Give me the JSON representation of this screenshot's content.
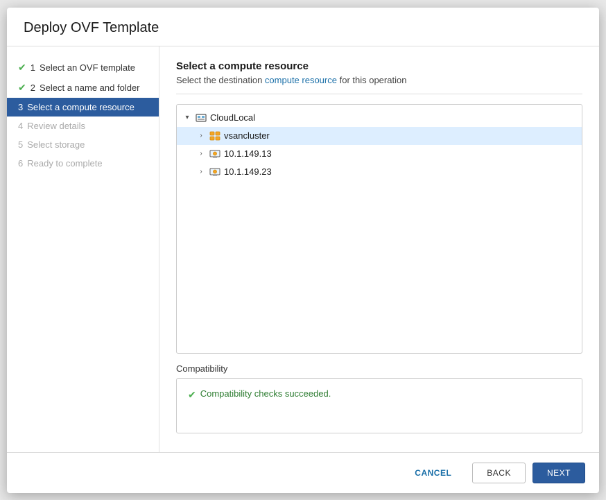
{
  "dialog": {
    "title": "Deploy OVF Template"
  },
  "sidebar": {
    "items": [
      {
        "id": "step1",
        "number": "1",
        "label": "Select an OVF template",
        "state": "completed"
      },
      {
        "id": "step2",
        "number": "2",
        "label": "Select a name and folder",
        "state": "completed"
      },
      {
        "id": "step3",
        "number": "3",
        "label": "Select a compute resource",
        "state": "active"
      },
      {
        "id": "step4",
        "number": "4",
        "label": "Review details",
        "state": "disabled"
      },
      {
        "id": "step5",
        "number": "5",
        "label": "Select storage",
        "state": "disabled"
      },
      {
        "id": "step6",
        "number": "6",
        "label": "Ready to complete",
        "state": "disabled"
      }
    ]
  },
  "main": {
    "section_title": "Select a compute resource",
    "section_subtitle": "Select the destination compute resource for this operation",
    "tree": {
      "root": {
        "label": "CloudLocal",
        "expanded": true,
        "children": [
          {
            "label": "vsancluster",
            "selected": true,
            "type": "cluster",
            "expanded": false
          },
          {
            "label": "10.1.149.13",
            "selected": false,
            "type": "host",
            "expanded": false
          },
          {
            "label": "10.1.149.23",
            "selected": false,
            "type": "host",
            "expanded": false
          }
        ]
      }
    },
    "compatibility": {
      "label": "Compatibility",
      "message": "Compatibility checks succeeded."
    }
  },
  "footer": {
    "cancel_label": "CANCEL",
    "back_label": "BACK",
    "next_label": "NEXT"
  }
}
